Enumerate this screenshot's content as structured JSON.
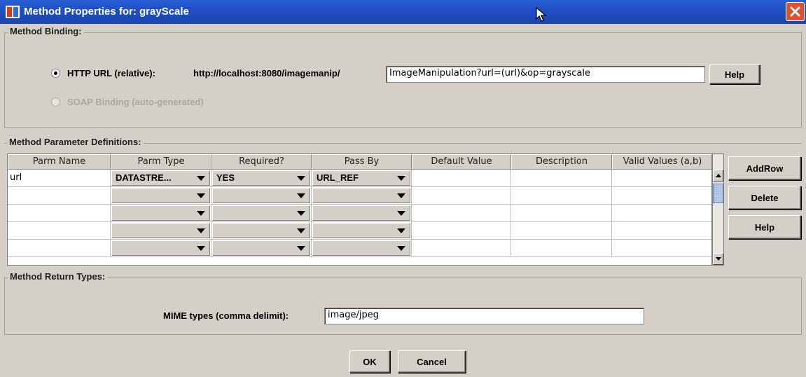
{
  "window": {
    "title": "Method Properties for: grayScale"
  },
  "binding": {
    "group_label": "Method Binding:",
    "http_label": "HTTP URL (relative):",
    "base_url": "http://localhost:8080/imagemanip/",
    "url_value": "ImageManipulation?url=(url)&op=grayscale",
    "help_label": "Help",
    "soap_label": "SOAP Binding (auto-generated)"
  },
  "params": {
    "group_label": "Method Parameter Definitions:",
    "columns": [
      "Parm Name",
      "Parm Type",
      "Required?",
      "Pass By",
      "Default Value",
      "Description",
      "Valid Values (a,b)"
    ],
    "rows": [
      {
        "name": "url",
        "type": "DATASTRE...",
        "required": "YES",
        "pass_by": "URL_REF",
        "default": "",
        "description": "",
        "valid": ""
      },
      {
        "name": "",
        "type": "",
        "required": "",
        "pass_by": "",
        "default": "",
        "description": "",
        "valid": ""
      },
      {
        "name": "",
        "type": "",
        "required": "",
        "pass_by": "",
        "default": "",
        "description": "",
        "valid": ""
      },
      {
        "name": "",
        "type": "",
        "required": "",
        "pass_by": "",
        "default": "",
        "description": "",
        "valid": ""
      },
      {
        "name": "",
        "type": "",
        "required": "",
        "pass_by": "",
        "default": "",
        "description": "",
        "valid": ""
      }
    ],
    "buttons": {
      "addrow": "AddRow",
      "delete": "Delete",
      "help": "Help"
    }
  },
  "returns": {
    "group_label": "Method Return Types:",
    "mime_label": "MIME types (comma delimit):",
    "mime_value": "image/jpeg"
  },
  "footer": {
    "ok": "OK",
    "cancel": "Cancel"
  },
  "icons": {
    "app": "app-logo-icon",
    "close": "close-icon",
    "cursor": "mouse-pointer-icon",
    "dropdown": "chevron-down-icon"
  }
}
